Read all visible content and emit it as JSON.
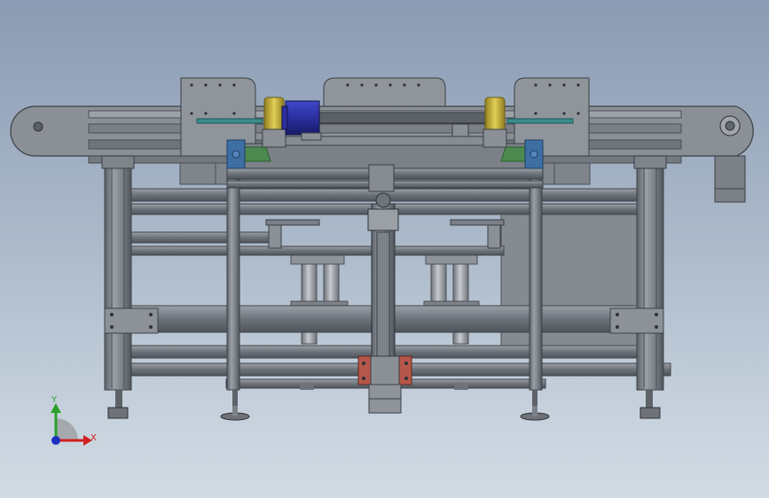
{
  "view": {
    "background_top": "#8a9bb3",
    "background_bottom": "#d2dbe4"
  },
  "triad": {
    "x_label": "X",
    "y_label": "Y",
    "x_color": "#d21f1f",
    "y_color": "#2aa02a",
    "z_color": "#1f2fbf"
  },
  "model": {
    "frame_color": "#7f858c",
    "panel_color": "#8e9399",
    "motor_color": "#2b2fa0",
    "roller_color": "#c8b33a",
    "bearing_color": "#3d6fa3",
    "guide_color": "#4c8a4f",
    "gripper_color": "#b5574a",
    "shaft_color": "#3a8d8a"
  }
}
